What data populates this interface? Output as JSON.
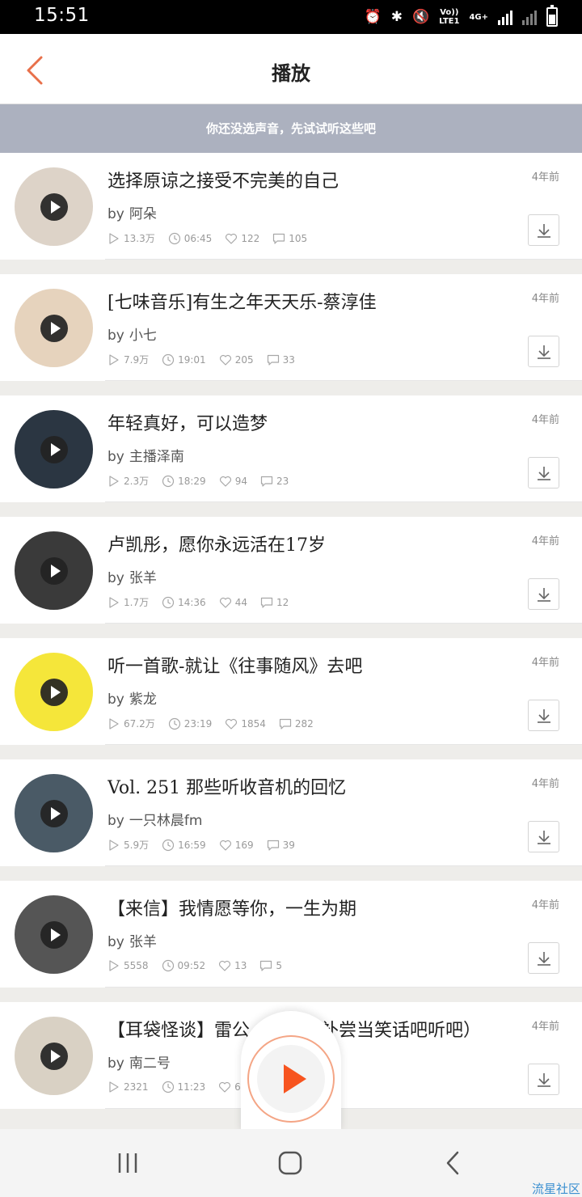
{
  "status_bar": {
    "time": "15:51",
    "network_label_top": "Vo))",
    "network_label_bottom": "LTE1",
    "data_label": "4G+"
  },
  "header": {
    "title": "播放",
    "back_icon": "chevron-left-icon",
    "accent": "#e8704a"
  },
  "hint": {
    "text": "你还没选声音，先试试听这些吧"
  },
  "items": [
    {
      "title": "选择原谅之接受不完美的自己",
      "by": "by",
      "author": "阿朵",
      "plays": "13.3万",
      "duration": "06:45",
      "likes": "122",
      "comments": "105",
      "ago": "4年前",
      "cover": "#ddd3c8"
    },
    {
      "title": "[七味音乐]有生之年天天乐-蔡淳佳",
      "by": "by",
      "author": "小七",
      "plays": "7.9万",
      "duration": "19:01",
      "likes": "205",
      "comments": "33",
      "ago": "4年前",
      "cover": "#e6d3bd"
    },
    {
      "title": "年轻真好，可以造梦",
      "by": "by",
      "author": "主播泽南",
      "plays": "2.3万",
      "duration": "18:29",
      "likes": "94",
      "comments": "23",
      "ago": "4年前",
      "cover": "#2b3642"
    },
    {
      "title": "卢凯彤，愿你永远活在17岁",
      "by": "by",
      "author": "张羊",
      "plays": "1.7万",
      "duration": "14:36",
      "likes": "44",
      "comments": "12",
      "ago": "4年前",
      "cover": "#3a3a3a"
    },
    {
      "title": "听一首歌-就让《往事随风》去吧",
      "by": "by",
      "author": "紫龙",
      "plays": "67.2万",
      "duration": "23:19",
      "likes": "1854",
      "comments": "282",
      "ago": "4年前",
      "cover": "#f5e63a"
    },
    {
      "title": "Vol. 251 那些听收音机的回忆",
      "by": "by",
      "author": "一只林晨fm",
      "plays": "5.9万",
      "duration": "16:59",
      "likes": "169",
      "comments": "39",
      "ago": "4年前",
      "cover": "#4a5a66"
    },
    {
      "title": "【来信】我情愿等你，一生为期",
      "by": "by",
      "author": "张羊",
      "plays": "5558",
      "duration": "09:52",
      "likes": "13",
      "comments": "5",
      "ago": "4年前",
      "cover": "#555555"
    },
    {
      "title": "【耳袋怪谈】雷公（这期是补尝当笑话吧听吧）",
      "by": "by",
      "author": "南二号",
      "plays": "2321",
      "duration": "11:23",
      "likes": "6",
      "comments": "",
      "ago": "4年前",
      "cover": "#d9d1c4"
    }
  ],
  "player": {
    "icon": "play-icon",
    "color": "#f7541f"
  },
  "nav": {
    "recents_icon": "recents-icon",
    "home_icon": "home-icon",
    "back_icon": "back-icon"
  },
  "watermark": "流星社区"
}
